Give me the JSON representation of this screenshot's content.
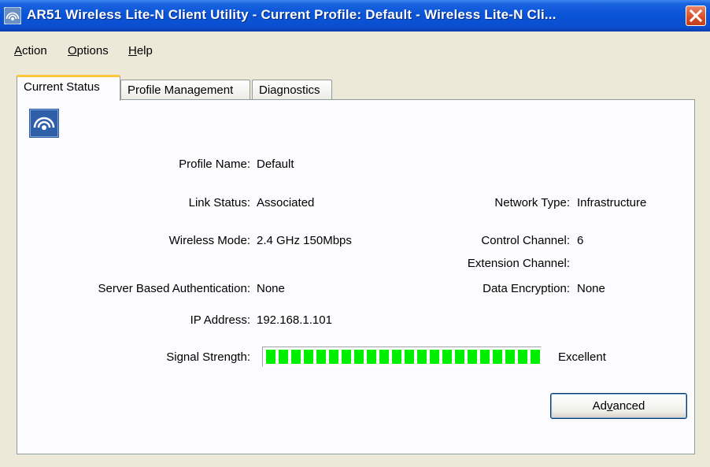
{
  "window": {
    "title": "AR51 Wireless Lite-N Client Utility - Current Profile: Default - Wireless Lite-N Cli...",
    "close_icon": "close-x-icon",
    "app_icon": "wireless-signal-icon",
    "accent": "#0A54D8"
  },
  "menu": [
    {
      "label": "Action",
      "mnemonic": "A"
    },
    {
      "label": "Options",
      "mnemonic": "O"
    },
    {
      "label": "Help",
      "mnemonic": "H"
    }
  ],
  "tabs": [
    {
      "label": "Current Status",
      "active": true
    },
    {
      "label": "Profile Management",
      "active": false
    },
    {
      "label": "Diagnostics",
      "active": false
    }
  ],
  "status": {
    "profile_name_label": "Profile Name:",
    "profile_name": "Default",
    "link_status_label": "Link Status:",
    "link_status": "Associated",
    "wireless_mode_label": "Wireless Mode:",
    "wireless_mode": "2.4 GHz 150Mbps",
    "server_auth_label": "Server Based Authentication:",
    "server_auth": "None",
    "ip_address_label": "IP Address:",
    "ip_address": "192.168.1.101",
    "network_type_label": "Network Type:",
    "network_type": "Infrastructure",
    "control_channel_label": "Control Channel:",
    "control_channel": "6",
    "extension_channel_label": "Extension Channel:",
    "extension_channel": "",
    "data_encryption_label": "Data Encryption:",
    "data_encryption": "None",
    "signal_strength_label": "Signal Strength:",
    "signal_strength_text": "Excellent",
    "signal_level": 1.0,
    "signal_color": "#00EE00"
  },
  "buttons": {
    "advanced_label": "Advanced"
  }
}
